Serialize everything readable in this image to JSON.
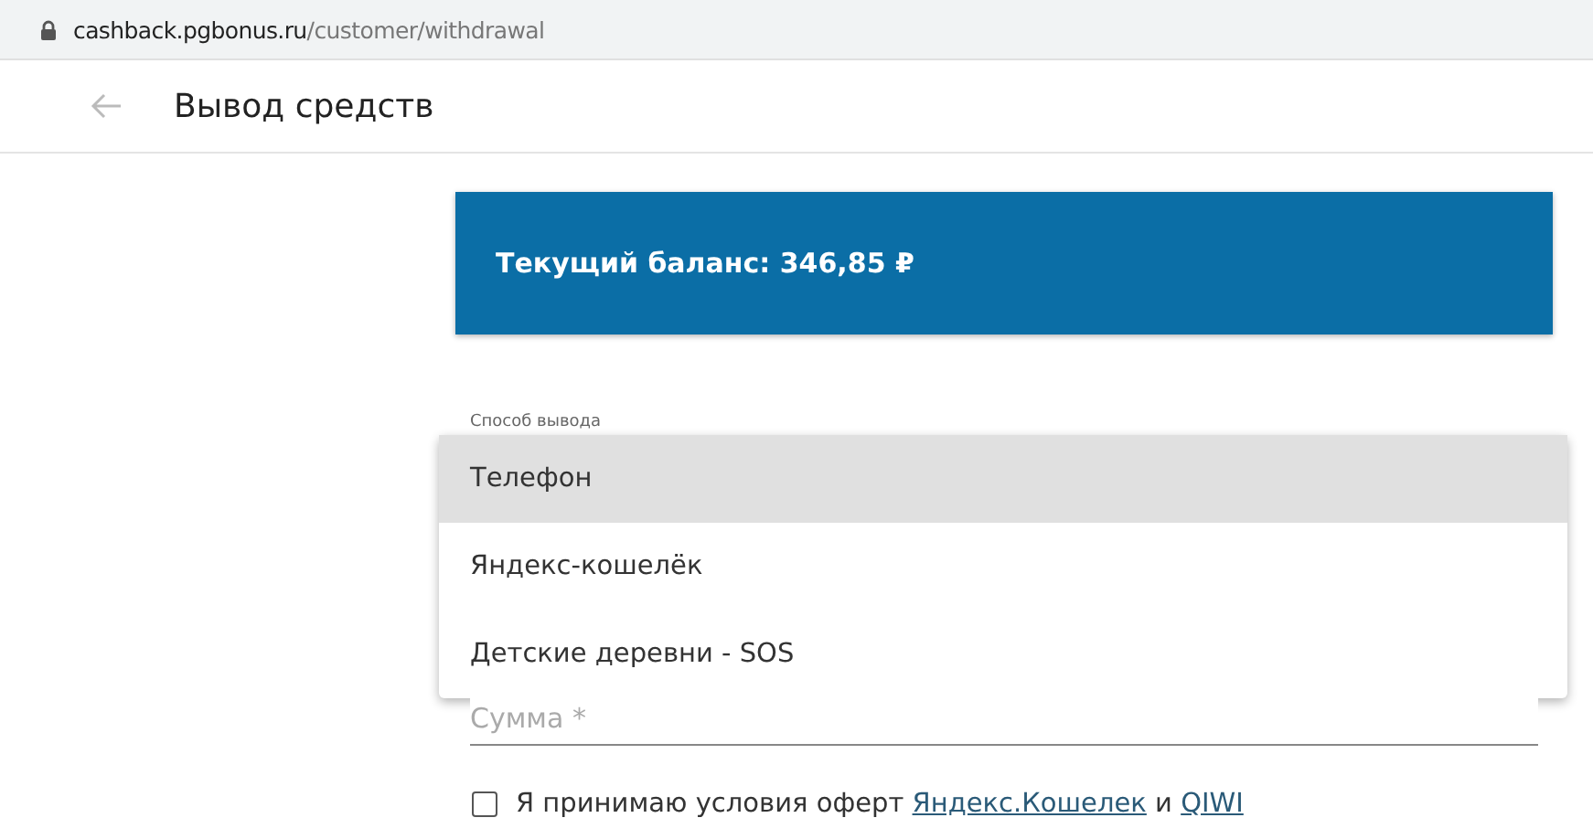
{
  "browser": {
    "url_host": "cashback.pgbonus.ru",
    "url_path": "/customer/withdrawal"
  },
  "header": {
    "title": "Вывод средств"
  },
  "balance": {
    "text": "Текущий баланс: 346,85 ₽"
  },
  "method_field": {
    "label": "Способ вывода"
  },
  "method_menu": [
    {
      "label": "Телефон",
      "selected": true
    },
    {
      "label": "Яндекс-кошелёк",
      "selected": false
    },
    {
      "label": "Детские деревни - SOS",
      "selected": false
    }
  ],
  "amount_field": {
    "placeholder": "Сумма *"
  },
  "consent": {
    "checked": false,
    "parts": [
      {
        "kind": "text",
        "text": "Я принимаю условия оферт"
      },
      {
        "kind": "link",
        "text": "Яндекс.Кошелек"
      },
      {
        "kind": "text",
        "text": "и"
      },
      {
        "kind": "link",
        "text": "QIWI"
      }
    ]
  }
}
